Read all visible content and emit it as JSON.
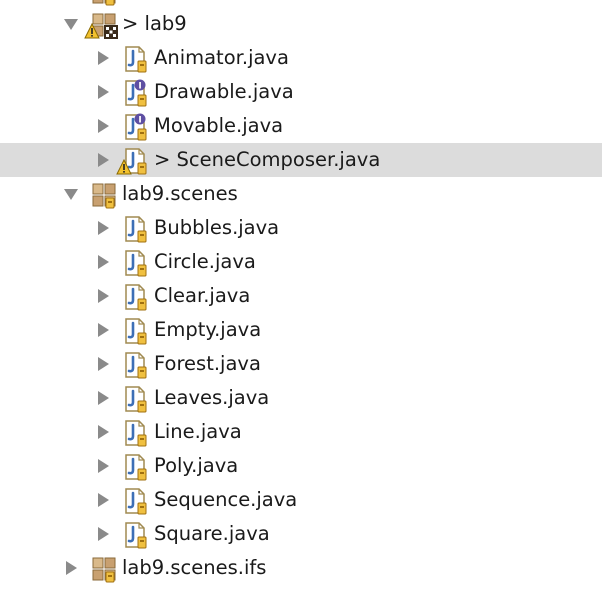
{
  "tree": {
    "items": [
      {
        "label": "",
        "type": "package",
        "expanded": false,
        "partial": true
      },
      {
        "label": "> lab9",
        "type": "package",
        "expanded": true,
        "badge": "warning"
      },
      {
        "label": "Animator.java",
        "type": "class"
      },
      {
        "label": "Drawable.java",
        "type": "interface"
      },
      {
        "label": "Movable.java",
        "type": "interface"
      },
      {
        "label": "> SceneComposer.java",
        "type": "class",
        "badge": "warning",
        "selected": true
      },
      {
        "label": "lab9.scenes",
        "type": "package",
        "expanded": true
      },
      {
        "label": "Bubbles.java",
        "type": "class"
      },
      {
        "label": "Circle.java",
        "type": "class"
      },
      {
        "label": "Clear.java",
        "type": "class"
      },
      {
        "label": "Empty.java",
        "type": "class"
      },
      {
        "label": "Forest.java",
        "type": "class"
      },
      {
        "label": "Leaves.java",
        "type": "class"
      },
      {
        "label": "Line.java",
        "type": "class"
      },
      {
        "label": "Poly.java",
        "type": "class"
      },
      {
        "label": "Sequence.java",
        "type": "class"
      },
      {
        "label": "Square.java",
        "type": "class"
      },
      {
        "label": "lab9.scenes.ifs",
        "type": "package",
        "expanded": false
      }
    ]
  },
  "icons": {
    "expanded": "chevron-down-icon",
    "collapsed": "chevron-right-icon",
    "class": "java-file-icon",
    "interface": "java-interface-icon",
    "package": "package-icon",
    "warning": "warning-icon"
  },
  "colors": {
    "selection": "#dcdcdc",
    "arrow": "#8a8a8a",
    "interface_badge": "#5e4fa2",
    "warning_badge": "#f2c12e"
  }
}
